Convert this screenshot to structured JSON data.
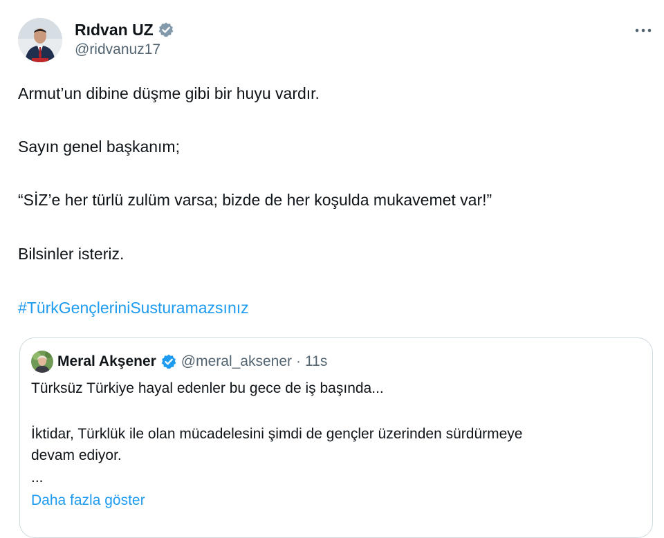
{
  "author": {
    "name": "Rıdvan UZ",
    "handle": "@ridvanuz17",
    "verified_badge": "gray-verified-badge-icon",
    "avatar_icon": "profile-photo"
  },
  "menu": {
    "more_icon": "more-horizontal-icon"
  },
  "tweet": {
    "line1": "Armut’un dibine düşme gibi bir huyu vardır.",
    "line2": "Sayın genel başkanım;",
    "line3": "“SİZ’e  her türlü zulüm varsa; bizde de her koşulda mukavemet var!”",
    "line4": "Bilsinler isteriz.",
    "hashtag": "#TürkGençleriniSusturamazsınız"
  },
  "quote": {
    "name": "Meral Akşener",
    "handle": "@meral_aksener",
    "dot": "·",
    "time": "11s",
    "line1": "Türksüz Türkiye hayal edenler bu gece de iş başında...",
    "line2": "İktidar, Türklük ile olan mücadelesini şimdi de gençler üzerinden sürdürmeye",
    "line3": "devam ediyor.",
    "line4": "...",
    "show_more": "Daha fazla göster"
  },
  "colors": {
    "link": "#1d9bf0",
    "text": "#0f1419",
    "muted": "#536471",
    "border": "#cfd9de",
    "verified_blue": "#1d9bf0",
    "verified_gray": "#829aab"
  }
}
